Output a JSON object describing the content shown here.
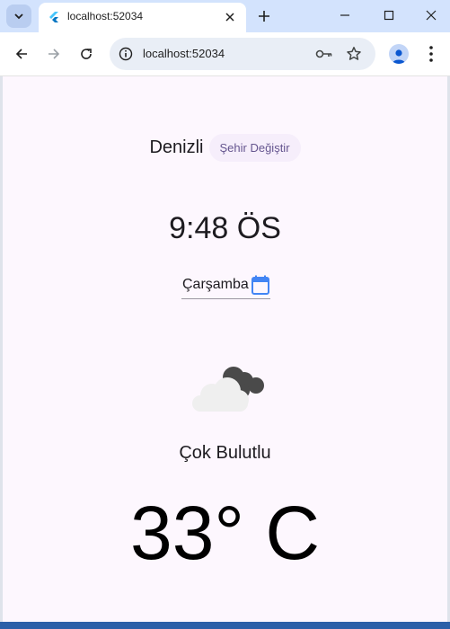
{
  "browser": {
    "tab_title": "localhost:52034",
    "url": "localhost:52034"
  },
  "weather": {
    "city": "Denizli",
    "change_city_label": "Şehir Değiştir",
    "time": "9:48 ÖS",
    "day": "Çarşamba",
    "condition": "Çok Bulutlu",
    "temperature": "33° C"
  },
  "colors": {
    "page_bg": "#fdf7fe",
    "accent": "#65558f",
    "calendar_icon": "#4285f4"
  },
  "icons": {
    "tab_search": "chevron-down-icon",
    "favicon": "flutter-icon",
    "tab_close": "close-icon",
    "new_tab": "plus-icon",
    "back": "arrow-left-icon",
    "forward": "arrow-right-icon",
    "reload": "reload-icon",
    "site_info": "info-icon",
    "password": "key-icon",
    "bookmark": "star-icon",
    "profile": "person-icon",
    "menu": "more-vert-icon",
    "day_picker": "calendar-icon",
    "weather": "cloud-icon"
  }
}
